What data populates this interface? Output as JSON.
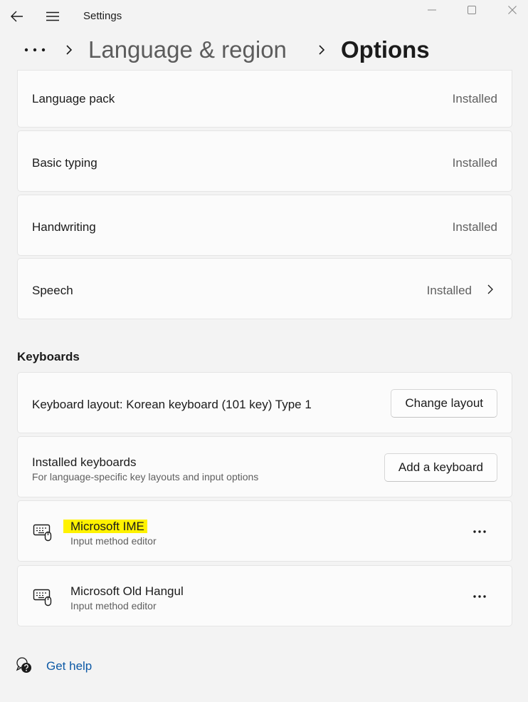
{
  "titlebar": {
    "app_title": "Settings",
    "back_icon": "back-arrow-icon",
    "menu_icon": "hamburger-menu-icon",
    "controls": [
      "minimize-icon",
      "maximize-icon",
      "close-icon"
    ]
  },
  "breadcrumb": {
    "more_icon": "more-dots-icon",
    "parent": "Language & region",
    "current": "Options"
  },
  "features": [
    {
      "label": "Language pack",
      "status": "Installed"
    },
    {
      "label": "Basic typing",
      "status": "Installed"
    },
    {
      "label": "Handwriting",
      "status": "Installed"
    },
    {
      "label": "Speech",
      "status": "Installed",
      "chevron_icon": "chevron-right-icon"
    }
  ],
  "keyboards": {
    "section_title": "Keyboards",
    "layout": {
      "label": "Keyboard layout: Korean keyboard (101 key) Type 1",
      "button": "Change layout"
    },
    "installed": {
      "title": "Installed keyboards",
      "subtitle": "For language-specific key layouts and input options",
      "button": "Add a keyboard"
    },
    "items": [
      {
        "name": "Microsoft IME",
        "description": "Input method editor",
        "icon": "keyboard-icon",
        "highlighted": true,
        "highlight_color": "#fff200"
      },
      {
        "name": "Microsoft Old Hangul",
        "description": "Input method editor",
        "icon": "keyboard-icon",
        "highlighted": false
      }
    ]
  },
  "help": {
    "label": "Get help",
    "icon": "help-icon",
    "link_color": "#0e5aa6"
  }
}
